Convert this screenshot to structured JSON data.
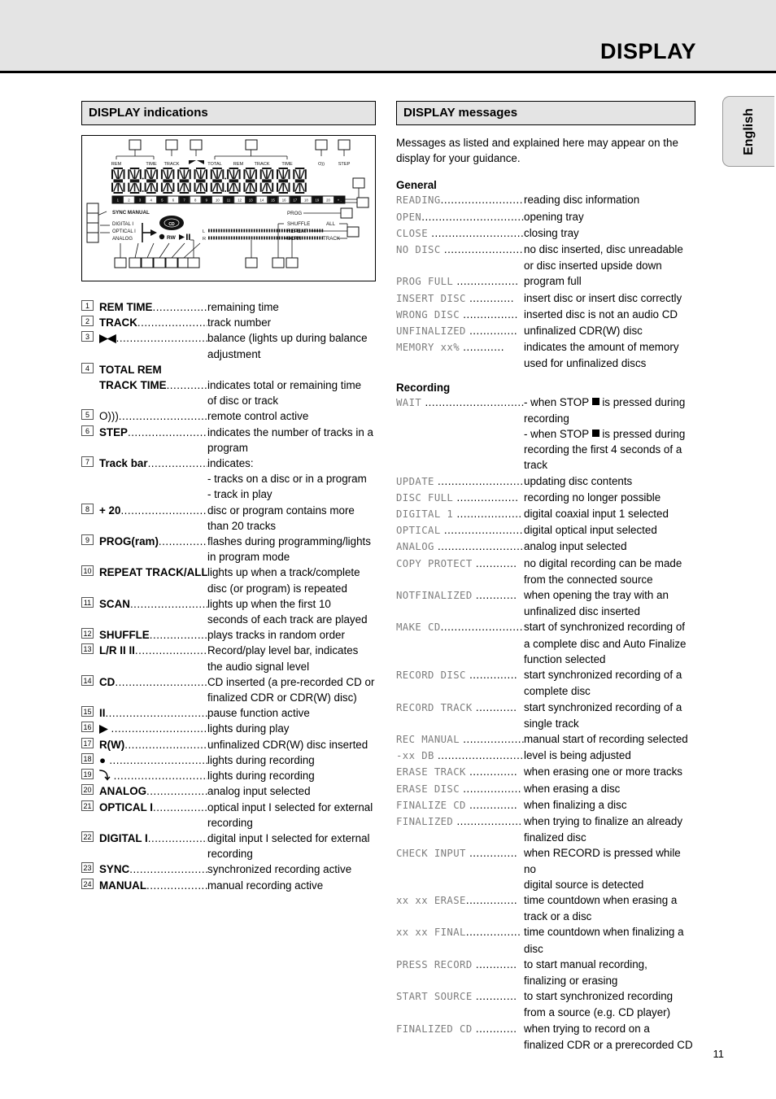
{
  "header": {
    "title": "DISPLAY"
  },
  "lang_tab": {
    "label": "English"
  },
  "page_number": "11",
  "left": {
    "section_title": "DISPLAY indications",
    "diagram": {
      "top_labels": [
        "REM",
        "TIME",
        "TRACK",
        "▶◀",
        "TOTAL",
        "REM",
        "TRACK",
        "TIME",
        "O))",
        "STEP"
      ],
      "track_numbers": [
        "1",
        "2",
        "3",
        "4",
        "5",
        "6",
        "7",
        "8",
        "9",
        "10",
        "11",
        "12",
        "13",
        "14",
        "15",
        "16",
        "17",
        "18",
        "19",
        "20",
        "+ ."
      ],
      "sync_manual": "SYNC MANUAL",
      "inputs": [
        "DIGITAL I",
        "OPTICAL I",
        "ANALOG"
      ],
      "transport": [
        "RW",
        "▶",
        "II"
      ],
      "cd_icon": "CD",
      "level_left": "L",
      "level_right": "R",
      "modes": [
        "PROG",
        "SHUFFLE",
        "REPEAT",
        "SCAN"
      ],
      "mode_extras": [
        "ALL",
        "TRACK"
      ]
    },
    "items": [
      {
        "n": "1",
        "term": "REM TIME",
        "bold": true,
        "dots": "..................",
        "def": "remaining time",
        "cont": []
      },
      {
        "n": "2",
        "term": "TRACK",
        "bold": true,
        "dots": "........................",
        "def": "track number",
        "cont": []
      },
      {
        "n": "3",
        "term": "▶◀",
        "bold": true,
        "dots": ".............................",
        "def": "balance (lights up during balance",
        "cont": [
          "adjustment"
        ]
      },
      {
        "n": "4",
        "term": "TOTAL REM",
        "bold": true,
        "dots": "",
        "def": "",
        "cont": []
      },
      {
        "n": "",
        "term": "TRACK TIME",
        "bold": true,
        "dots": "..............",
        "def": "indicates total or remaining time",
        "cont": [
          "of disc or track"
        ]
      },
      {
        "n": "5",
        "term": "O)))",
        "bold": false,
        "dots": ".................................",
        "def": "remote control active",
        "cont": []
      },
      {
        "n": "6",
        "term": "STEP",
        "bold": true,
        "dots": "............................",
        "def": "indicates the number of tracks in a",
        "cont": [
          "program"
        ]
      },
      {
        "n": "7",
        "term": "Track bar",
        "bold": true,
        "dots": "....................",
        "def": "indicates:",
        "cont": [
          "- tracks on a disc or in a program",
          "- track in play"
        ]
      },
      {
        "n": "8",
        "term": "+ 20",
        "bold": true,
        "dots": ".............................",
        "def": "disc or program contains more",
        "cont": [
          "than 20 tracks"
        ]
      },
      {
        "n": "9",
        "term": "PROG(ram)",
        "bold": true,
        "dots": ".................",
        "def": "flashes during programming/lights",
        "cont": [
          "in program mode"
        ]
      },
      {
        "n": "10",
        "term": "REPEAT TRACK/ALL",
        "bold": true,
        "dots": "..",
        "def": "lights up when a track/complete",
        "cont": [
          "disc (or program) is repeated"
        ]
      },
      {
        "n": "11",
        "term": "SCAN",
        "bold": true,
        "dots": "..........................",
        "def": "lights up when the first 10",
        "cont": [
          "seconds of each track are played"
        ]
      },
      {
        "n": "12",
        "term": "SHUFFLE",
        "bold": true,
        "dots": ".....................",
        "def": "plays tracks in random order",
        "cont": []
      },
      {
        "n": "13",
        "term": "L/R II  II",
        "bold": true,
        "dots": "......................",
        "def": "Record/play level bar, indicates",
        "cont": [
          "the audio signal level"
        ]
      },
      {
        "n": "14",
        "term": "CD",
        "bold": true,
        "dots": "..............................",
        "def": "CD inserted (a pre-recorded CD or",
        "cont": [
          "finalized CDR or CDR(W) disc)"
        ]
      },
      {
        "n": "15",
        "term": "II",
        "bold": true,
        "dots": "..................................",
        "def": "pause function active",
        "cont": []
      },
      {
        "n": "16",
        "term": "▶",
        "bold": true,
        "dots": " ...............................",
        "def": "lights during play",
        "cont": []
      },
      {
        "n": "17",
        "term": "R(W)",
        "bold": true,
        "dots": "...........................",
        "def": "unfinalized CDR(W) disc inserted",
        "cont": []
      },
      {
        "n": "18",
        "term": "●",
        "bold": true,
        "dots": " ................................",
        "def": "lights during recording",
        "cont": []
      },
      {
        "n": "19",
        "term": "⤵",
        "bold": true,
        "dots": " ................................",
        "def": "lights during recording",
        "cont": []
      },
      {
        "n": "20",
        "term": "ANALOG",
        "bold": true,
        "dots": ".....................",
        "def": "analog input selected",
        "cont": []
      },
      {
        "n": "21",
        "term": "OPTICAL I",
        "bold": true,
        "dots": "..................",
        "def": "optical input I selected for external",
        "cont": [
          "recording"
        ]
      },
      {
        "n": "22",
        "term": "DIGITAL I",
        "bold": true,
        "dots": "....................",
        "def": "digital input I selected for external",
        "cont": [
          "recording"
        ]
      },
      {
        "n": "23",
        "term": "SYNC",
        "bold": true,
        "dots": "..........................",
        "def": "synchronized recording active",
        "cont": []
      },
      {
        "n": "24",
        "term": "MANUAL",
        "bold": true,
        "dots": "....................",
        "def": "manual recording active",
        "cont": []
      }
    ]
  },
  "right": {
    "section_title": "DISPLAY messages",
    "intro": "Messages as listed and explained here may appear on the display for your guidance.",
    "general_heading": "General",
    "general": [
      {
        "msg": "READING",
        "dots": "........................",
        "def": "reading disc information",
        "cont": []
      },
      {
        "msg": "OPEN",
        "dots": "..................................",
        "def": "opening tray",
        "cont": []
      },
      {
        "msg": "CLOSE",
        "dots": " .............................",
        "def": "closing tray",
        "cont": []
      },
      {
        "msg": "NO DISC",
        "dots": " ........................",
        "def": "no disc inserted, disc unreadable",
        "cont": [
          "or disc inserted upside down"
        ]
      },
      {
        "msg": "PROG FULL",
        "dots": " ..................",
        "def": "program full",
        "cont": []
      },
      {
        "msg": "INSERT DISC",
        "dots": " .............",
        "def": "insert disc or insert disc correctly",
        "cont": []
      },
      {
        "msg": "WRONG DISC",
        "dots": " ................",
        "def": "inserted disc is not an audio CD",
        "cont": []
      },
      {
        "msg": "UNFINALIZED",
        "dots": " ..............",
        "def": "unfinalized CDR(W) disc",
        "cont": []
      },
      {
        "msg": "MEMORY xx%",
        "dots": " ............",
        "def": "indicates the amount of memory",
        "cont": [
          "used for unfinalized discs"
        ]
      }
    ],
    "recording_heading": "Recording",
    "recording": [
      {
        "msg": "WAIT",
        "dots": " .................................",
        "def": "- when STOP ■ is pressed during",
        "cont": [
          "recording",
          "- when STOP ■ is pressed during",
          "recording the first 4 seconds of a",
          "track"
        ]
      },
      {
        "msg": "UPDATE",
        "dots": "  .........................",
        "def": "updating disc contents",
        "cont": []
      },
      {
        "msg": "DISC FULL",
        "dots": " ..................",
        "def": "recording no longer possible",
        "cont": []
      },
      {
        "msg": "DIGITAL 1",
        "dots": " ...................",
        "def": "digital coaxial input 1 selected",
        "cont": []
      },
      {
        "msg": "OPTICAL",
        "dots": " .......................",
        "def": "digital optical input selected",
        "cont": []
      },
      {
        "msg": "ANALOG",
        "dots": " ...........................",
        "def": "analog input selected",
        "cont": []
      },
      {
        "msg": "COPY PROTECT",
        "dots": " ............",
        "def": "no digital recording can be made",
        "cont": [
          "from the connected source"
        ]
      },
      {
        "msg": "NOTFINALIZED",
        "dots": " ............",
        "def": "when opening the tray with an",
        "cont": [
          "unfinalized disc inserted"
        ]
      },
      {
        "msg": "MAKE CD",
        "dots": "........................",
        "def": "start of synchronized recording of",
        "cont": [
          "a complete disc and Auto Finalize",
          "function selected"
        ]
      },
      {
        "msg": "RECORD DISC",
        "dots": " ..............",
        "def": "start synchronized recording of a",
        "cont": [
          "complete disc"
        ]
      },
      {
        "msg": "RECORD TRACK",
        "dots": " ............",
        "def": "start synchronized recording of a",
        "cont": [
          "single track"
        ]
      },
      {
        "msg": "REC MANUAL",
        "dots": " ..................",
        "def": "manual start of recording selected",
        "cont": []
      },
      {
        "msg": "-xx DB",
        "dots": " ...........................",
        "def": "level is being adjusted",
        "cont": []
      },
      {
        "msg": "ERASE TRACK",
        "dots": " ..............",
        "def": "when erasing one or more tracks",
        "cont": []
      },
      {
        "msg": "ERASE DISC",
        "dots": " .................",
        "def": "when erasing a disc",
        "cont": []
      },
      {
        "msg": "FINALIZE CD",
        "dots": " ..............",
        "def": "when finalizing a disc",
        "cont": []
      },
      {
        "msg": "FINALIZED",
        "dots": " ...................",
        "def": "when trying to finalize an already",
        "cont": [
          "finalized disc"
        ]
      },
      {
        "msg": "CHECK INPUT",
        "dots": " ..............",
        "def": "when RECORD is pressed while no",
        "cont": [
          "digital source is detected"
        ]
      },
      {
        "msg": "xx xx ERASE",
        "dots": "...............",
        "def": "time countdown when erasing a",
        "cont": [
          "track or a disc"
        ]
      },
      {
        "msg": "xx xx FINAL",
        "dots": "................",
        "def": "time countdown when finalizing a",
        "cont": [
          "disc"
        ]
      },
      {
        "msg": "PRESS RECORD",
        "dots": " ............",
        "def": "to start manual recording,",
        "cont": [
          "finalizing or erasing"
        ]
      },
      {
        "msg": "START SOURCE",
        "dots": " ............",
        "def": "to start synchronized recording",
        "cont": [
          "from a source (e.g. CD player)"
        ]
      },
      {
        "msg": "FINALIZED CD",
        "dots": " ............",
        "def": "when trying to record on a",
        "cont": [
          "finalized CDR or a prerecorded CD"
        ]
      }
    ]
  }
}
